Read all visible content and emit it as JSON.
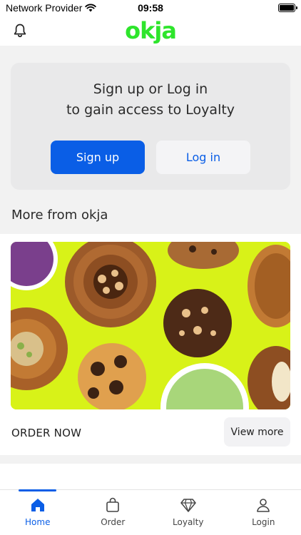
{
  "status_bar": {
    "carrier": "Network Provider",
    "time": "09:58",
    "icons": [
      "wifi-icon",
      "battery-icon"
    ]
  },
  "header": {
    "logo_text": "okja",
    "bell_icon": "bell-icon",
    "logo_color": "#2ee52c"
  },
  "loyalty": {
    "line1": "Sign up or Log in",
    "line2": "to gain access to Loyalty",
    "signup_label": "Sign up",
    "login_label": "Log in"
  },
  "section": {
    "title": "More from okja"
  },
  "promo": {
    "cta_text": "ORDER NOW",
    "view_more_label": "View more"
  },
  "bottom_nav": {
    "items": [
      {
        "label": "Home",
        "icon": "home-icon",
        "active": true
      },
      {
        "label": "Order",
        "icon": "bag-icon",
        "active": false
      },
      {
        "label": "Loyalty",
        "icon": "diamond-icon",
        "active": false
      },
      {
        "label": "Login",
        "icon": "person-icon",
        "active": false
      }
    ]
  },
  "colors": {
    "accent": "#0a5ee6",
    "brand_green": "#2ee52c",
    "promo_bg": "#d8f218"
  }
}
